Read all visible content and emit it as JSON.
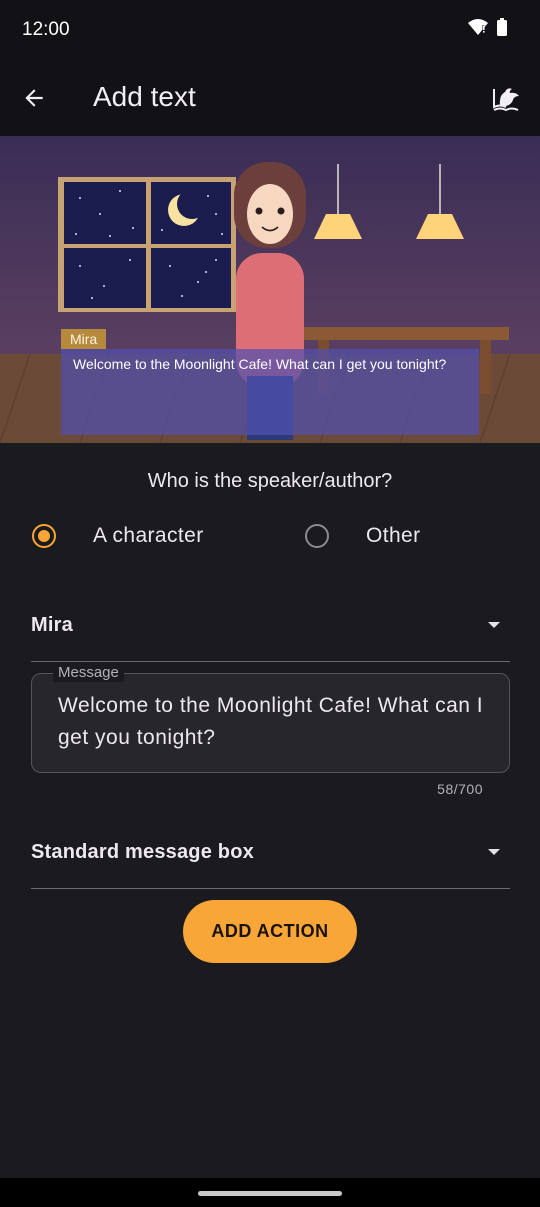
{
  "status_bar": {
    "time": "12:00"
  },
  "app_bar": {
    "title": "Add text",
    "action_icon": "theater-book-icon",
    "back_icon": "arrow-back-icon"
  },
  "scene": {
    "speaker_name": "Mira",
    "dialog_text": "Welcome to the Moonlight Cafe! What can I get you tonight?"
  },
  "form": {
    "speaker_question": "Who is the speaker/author?",
    "speaker_options": [
      {
        "label": "A character",
        "selected": true
      },
      {
        "label": "Other",
        "selected": false
      }
    ],
    "character_select": {
      "value": "Mira"
    },
    "message": {
      "label": "Message",
      "value": "Welcome to the Moonlight Cafe! What can I get you tonight?",
      "counter": "58/700"
    },
    "box_style_select": {
      "value": "Standard message box"
    },
    "add_action_label": "ADD ACTION"
  },
  "colors": {
    "accent": "#f8a638",
    "background": "#1b1a1f",
    "bar": "#121116",
    "dialog_box": "#5050af"
  }
}
